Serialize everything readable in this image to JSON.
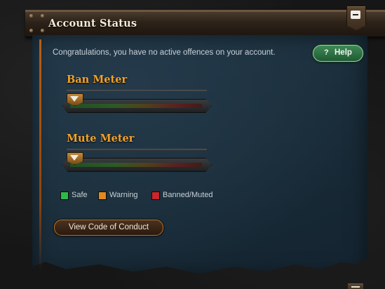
{
  "window": {
    "title": "Account Status",
    "collapse_icon": "minus-icon"
  },
  "status": {
    "message": "Congratulations, you have no active offences on your account."
  },
  "help": {
    "icon": "?",
    "label": "Help"
  },
  "meters": [
    {
      "title": "Ban Meter",
      "level": 0
    },
    {
      "title": "Mute Meter",
      "level": 0
    }
  ],
  "legend": [
    {
      "label": "Safe",
      "color": "#2fb84a"
    },
    {
      "label": "Warning",
      "color": "#e08a1e"
    },
    {
      "label": "Banned/Muted",
      "color": "#c8262a"
    }
  ],
  "actions": {
    "code_of_conduct_label": "View Code of Conduct"
  },
  "colors": {
    "accent_orange": "#f2a22a",
    "panel_blue": "#1a2d3a",
    "help_green": "#2f7a45"
  }
}
